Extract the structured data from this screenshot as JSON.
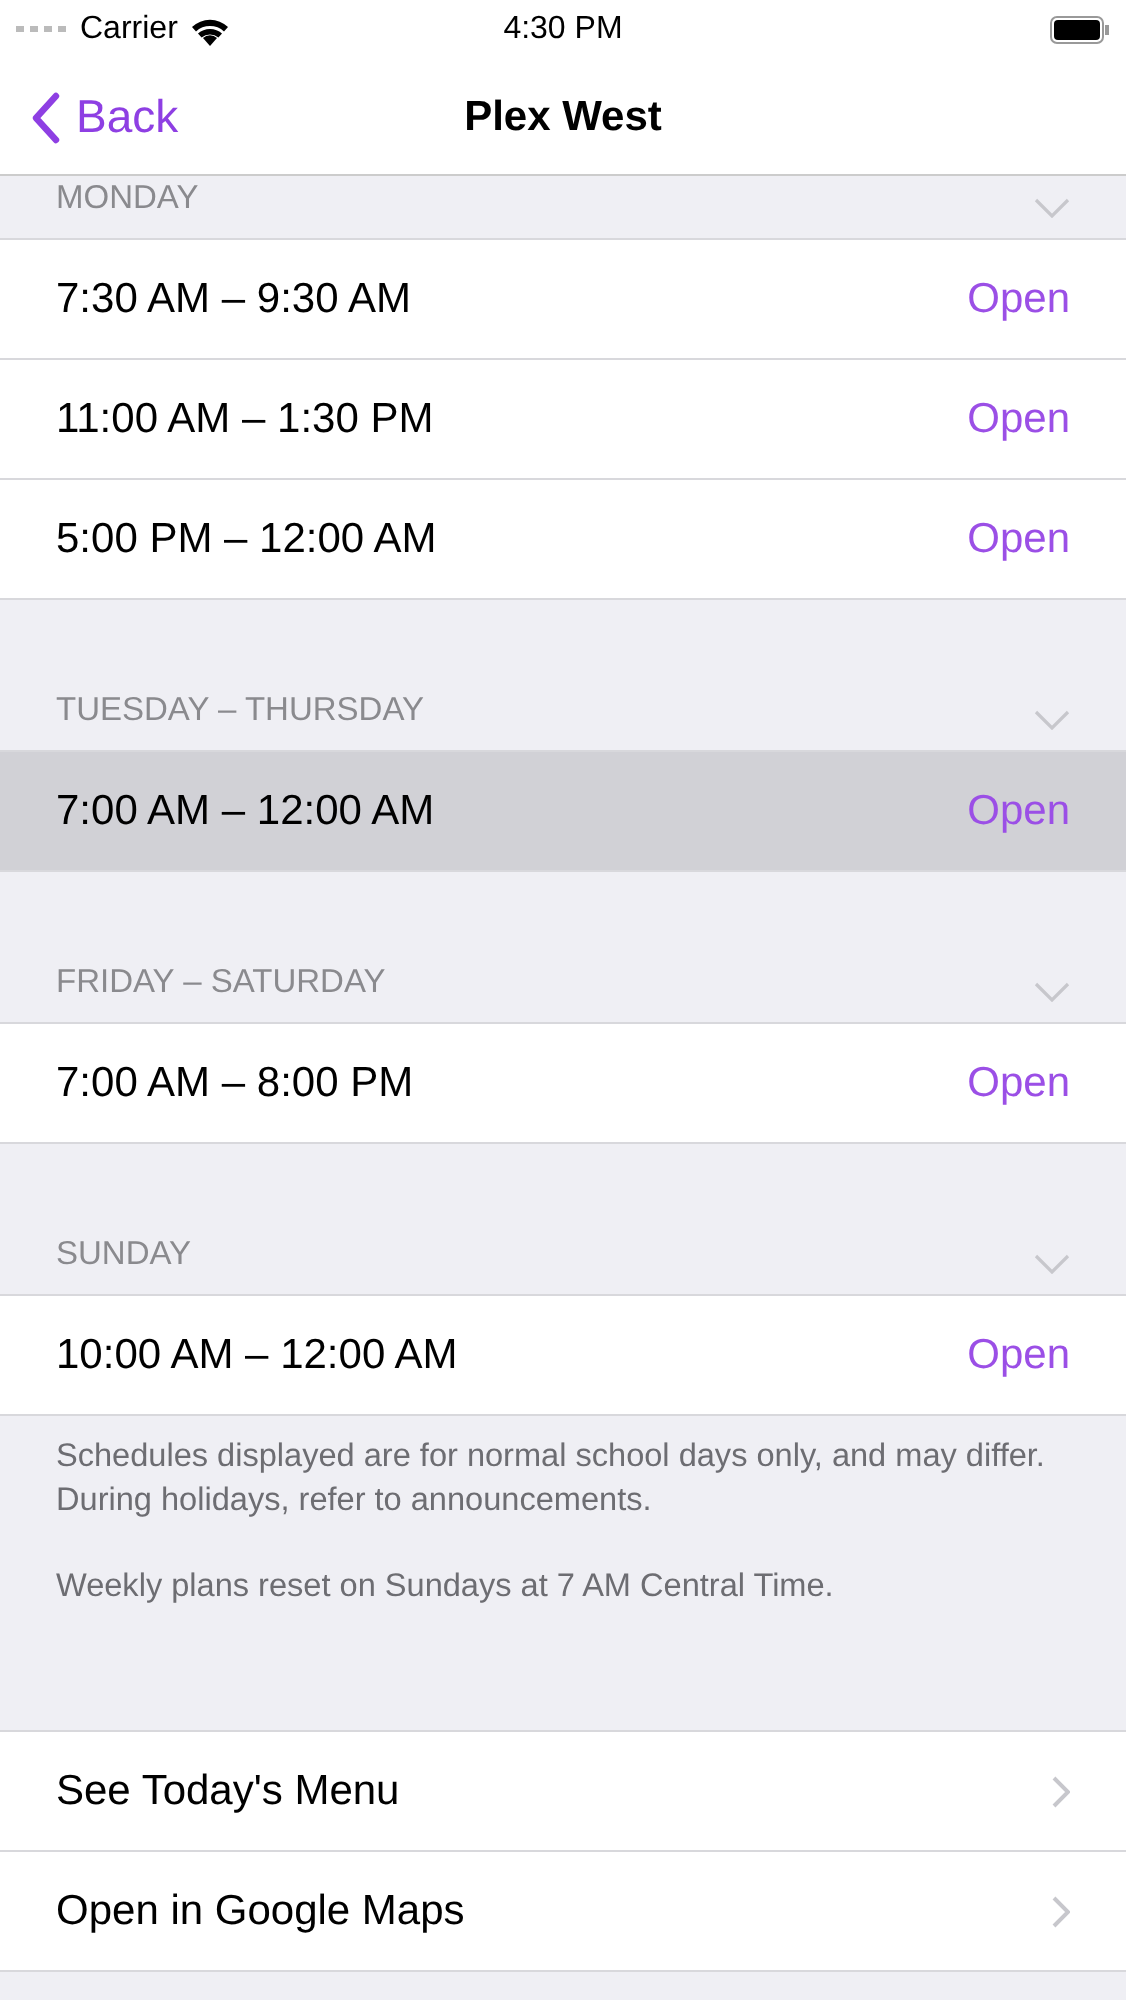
{
  "status_bar": {
    "carrier": "Carrier",
    "time": "4:30 PM"
  },
  "nav": {
    "back": "Back",
    "title": "Plex West"
  },
  "sections": [
    {
      "title": "MONDAY",
      "rows": [
        {
          "time": "7:30 AM – 9:30 AM",
          "action": "Open",
          "selected": false
        },
        {
          "time": "11:00 AM – 1:30 PM",
          "action": "Open",
          "selected": false
        },
        {
          "time": "5:00 PM – 12:00 AM",
          "action": "Open",
          "selected": false
        }
      ]
    },
    {
      "title": "TUESDAY – THURSDAY",
      "rows": [
        {
          "time": "7:00 AM – 12:00 AM",
          "action": "Open",
          "selected": true
        }
      ]
    },
    {
      "title": "FRIDAY – SATURDAY",
      "rows": [
        {
          "time": "7:00 AM – 8:00 PM",
          "action": "Open",
          "selected": false
        }
      ]
    },
    {
      "title": "SUNDAY",
      "rows": [
        {
          "time": "10:00 AM – 12:00 AM",
          "action": "Open",
          "selected": false
        }
      ]
    }
  ],
  "footer_notes": [
    "Schedules displayed are for normal school days only, and may differ. During holidays, refer to announcements.",
    "Weekly plans reset on Sundays at 7 AM Central Time."
  ],
  "links": [
    "See Today's Menu",
    "Open in Google Maps"
  ]
}
